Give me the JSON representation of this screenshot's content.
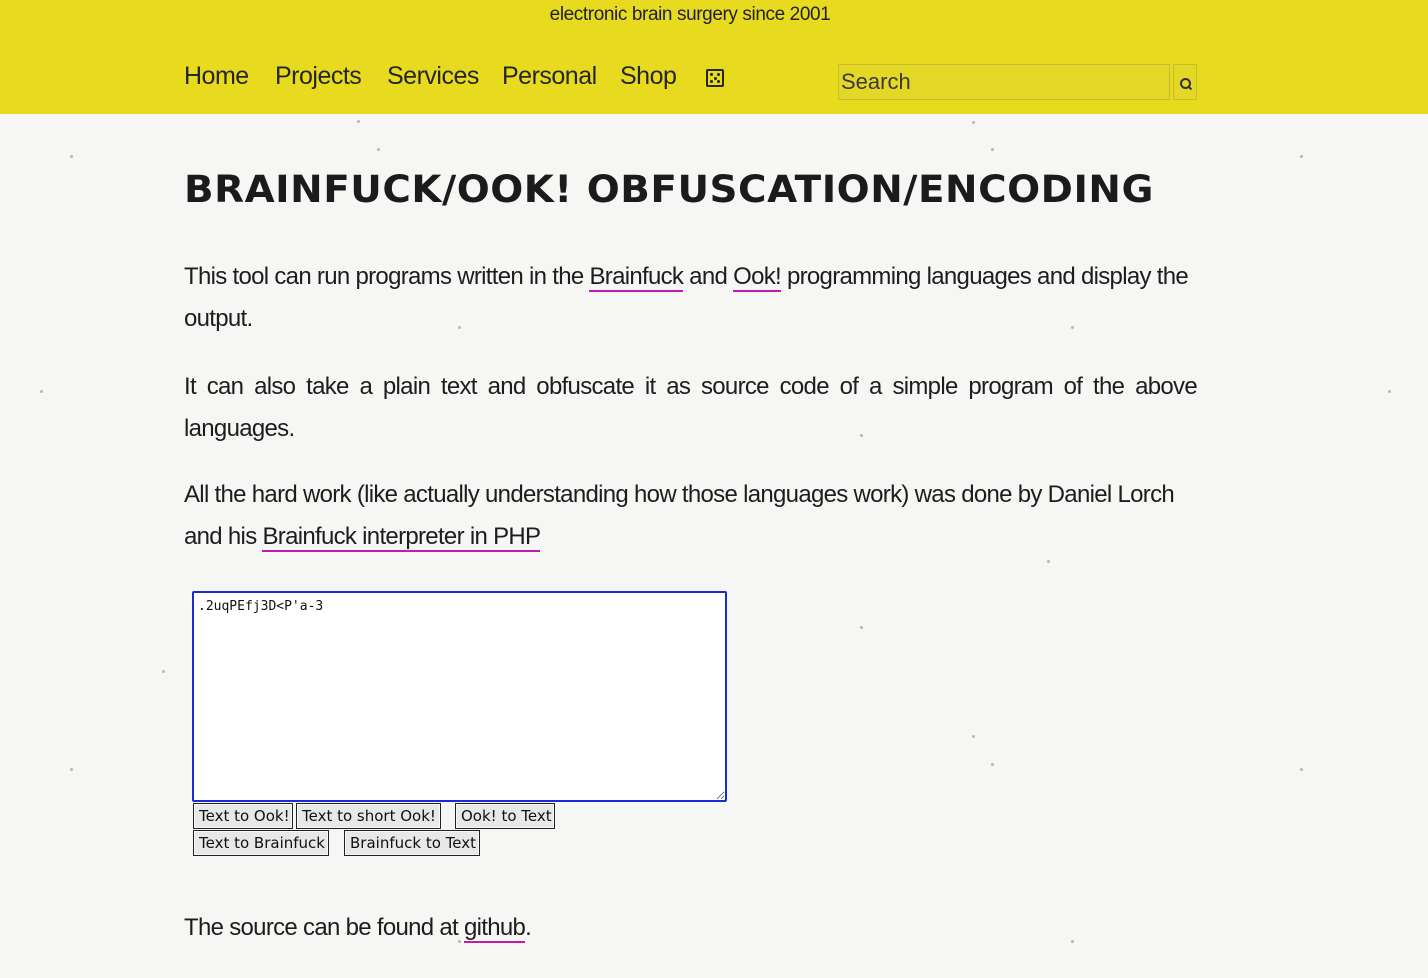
{
  "header": {
    "tagline": "electronic brain surgery since 2001",
    "nav": [
      {
        "label": "Home"
      },
      {
        "label": "Projects"
      },
      {
        "label": "Services"
      },
      {
        "label": "Personal"
      },
      {
        "label": "Shop"
      }
    ],
    "search": {
      "placeholder": "Search",
      "value": ""
    }
  },
  "main": {
    "title": "Brainfuck/Ook! Obfuscation/Encoding",
    "p1": {
      "text_before": "This tool can run programs written in the ",
      "link1": "Brainfuck",
      "text_mid": " and ",
      "link2": "Ook!",
      "text_after": " programming languages and display the output."
    },
    "p2": "It can also take a plain text and obfuscate it as source code of a simple program of the above languages.",
    "p3": {
      "text_before": "All the hard work (like actually understanding how those languages work) was done by Daniel Lorch and his ",
      "link": "Brainfuck interpreter in PHP"
    },
    "editor": {
      "value": ".2uqPEfj3D<P'a-3"
    },
    "buttons": {
      "text_to_ook": "Text to Ook!",
      "text_to_short_ook": "Text to short Ook!",
      "ook_to_text": "Ook! to Text",
      "text_to_brainfuck": "Text to Brainfuck",
      "brainfuck_to_text": "Brainfuck to Text"
    },
    "footer": {
      "text_before": "The source can be found at ",
      "link": "github",
      "text_after": "."
    }
  },
  "colors": {
    "header_bg": "#e7da1f",
    "link_underline": "#c01ab3",
    "focus_border": "#1a2bd0",
    "page_bg": "#f6f6f4"
  }
}
